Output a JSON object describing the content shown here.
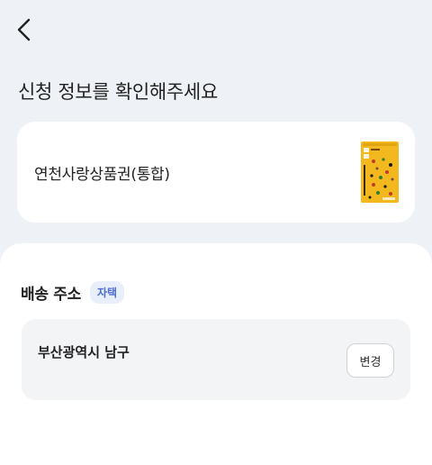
{
  "header": {
    "back_icon": "chevron-left-icon",
    "title": "신청 정보를 확인해주세요"
  },
  "product": {
    "name": "연천사랑상품권(통합)",
    "thumbnail_icon": "gift-card-thumbnail",
    "thumbnail_color": "#f2b81e"
  },
  "delivery": {
    "section_title": "배송 주소",
    "tag": "자택",
    "address": "부산광역시 남구",
    "change_label": "변경"
  },
  "colors": {
    "background": "#eef1f6",
    "tag_text": "#4e6ed6",
    "tag_bg": "#e9eefb"
  }
}
